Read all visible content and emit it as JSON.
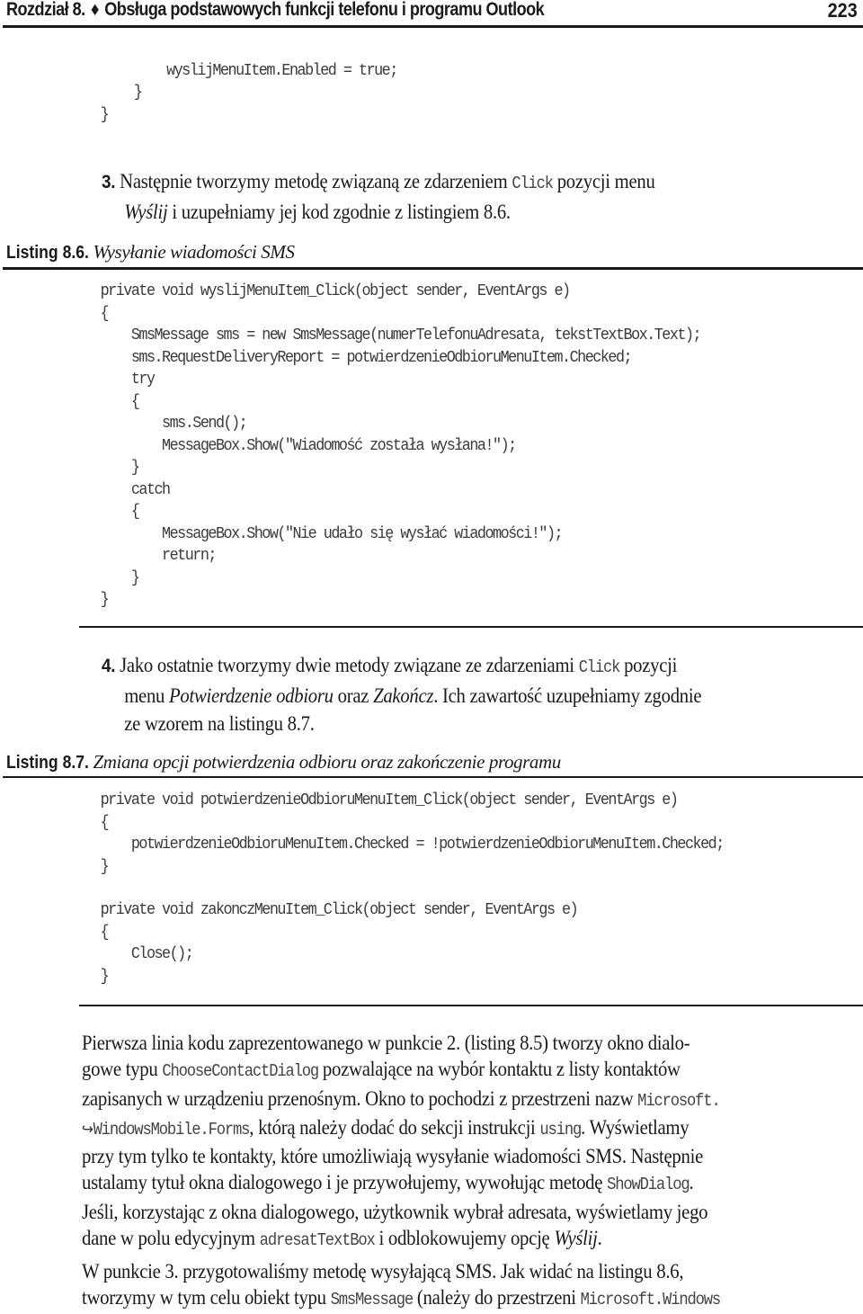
{
  "header": {
    "chapter": "Rozdział 8.",
    "separator_icon": "diamond-bullet",
    "separator_glyph": "♦",
    "title": "Obsługa podstawowych funkcji telefonu i programu Outlook",
    "page_number": "223"
  },
  "top_code": [
    "wyslijMenuItem.Enabled = true;",
    "}",
    "}"
  ],
  "step3": {
    "number": "3.",
    "line1_a": "Następnie tworzymy metodę związaną ze zdarzeniem ",
    "line1_code": "Click",
    "line1_b": " pozycji menu",
    "line2_italic": "Wyślij",
    "line2_rest": " i uzupełniamy jej kod zgodnie z listingiem 8.6."
  },
  "listing_8_6": {
    "label": "Listing 8.6.",
    "description": "Wysyłanie wiadomości SMS",
    "lines": [
      "private void wyslijMenuItem_Click(object sender, EventArgs e)",
      "{",
      "    SmsMessage sms = new SmsMessage(numerTelefonuAdresata, tekstTextBox.Text);",
      "    sms.RequestDeliveryReport = potwierdzenieOdbioruMenuItem.Checked;",
      "    try",
      "    {",
      "        sms.Send();",
      "        MessageBox.Show(\"Wiadomość została wysłana!\");",
      "    }",
      "    catch",
      "    {",
      "        MessageBox.Show(\"Nie udało się wysłać wiadomości!\");",
      "        return;",
      "    }",
      "}"
    ]
  },
  "step4": {
    "number": "4.",
    "line1_a": "Jako ostatnie tworzymy dwie metody związane ze zdarzeniami ",
    "line1_code": "Click",
    "line1_b": " pozycji",
    "line2_a": "menu ",
    "line2_italic1": "Potwierdzenie odbioru",
    "line2_b": " oraz ",
    "line2_italic2": "Zakończ",
    "line2_c": ". Ich zawartość uzupełniamy zgodnie",
    "line3": "ze wzorem na listingu 8.7."
  },
  "listing_8_7": {
    "label": "Listing 8.7.",
    "description": "Zmiana opcji potwierdzenia odbioru oraz zakończenie programu",
    "lines": [
      "private void potwierdzenieOdbioruMenuItem_Click(object sender, EventArgs e)",
      "{",
      "    potwierdzenieOdbioruMenuItem.Checked = !potwierdzenieOdbioruMenuItem.Checked;",
      "}",
      "",
      "private void zakonczMenuItem_Click(object sender, EventArgs e)",
      "{",
      "    Close();",
      "}"
    ]
  },
  "paragraph1": {
    "l1": "Pierwsza linia kodu zaprezentowanego w punkcie 2. (listing 8.5) tworzy okno dialo-",
    "l2_a": "gowe typu ",
    "l2_code": "ChooseContactDialog",
    "l2_b": " pozwalające na wybór kontaktu z listy kontaktów",
    "l3_a": "zapisanych w urządzeniu przenośnym. Okno to pochodzi z przestrzeni nazw ",
    "l3_code": "Microsoft.",
    "l4_arrow": "↪",
    "l4_code1": "WindowsMobile.Forms",
    "l4_a": ", którą należy dodać do sekcji instrukcji ",
    "l4_code2": "using",
    "l4_b": ". Wyświetlamy",
    "l5": "przy tym tylko te kontakty, które umożliwiają wysyłanie wiadomości SMS. Następnie",
    "l6_a": "ustalamy tytuł okna dialogowego i je przywołujemy, wywołując metodę ",
    "l6_code": "ShowDialog",
    "l6_b": ".",
    "l7": "Jeśli, korzystając z okna dialogowego, użytkownik wybrał adresata, wyświetlamy jego",
    "l8_a": "dane w polu edycyjnym ",
    "l8_code": "adresatTextBox",
    "l8_b": " i odblokowujemy opcję ",
    "l8_italic": "Wyślij",
    "l8_c": "."
  },
  "paragraph2": {
    "l1": "W punkcie 3. przygotowaliśmy metodę wysyłającą SMS. Jak widać na listingu 8.6,",
    "l2_a": "tworzymy w tym celu obiekt typu ",
    "l2_code1": "SmsMessage",
    "l2_b": " (należy do przestrzeni ",
    "l2_code2": "Microsoft.Windows"
  }
}
